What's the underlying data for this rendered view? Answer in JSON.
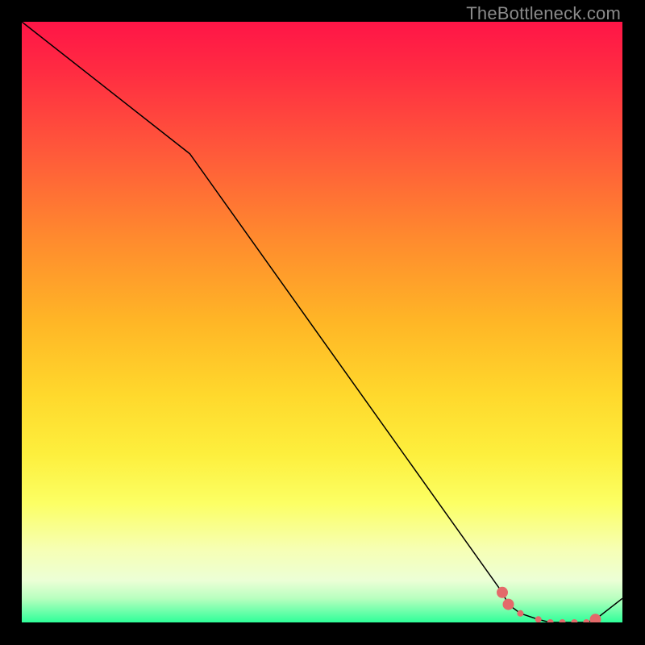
{
  "watermark": "TheBottleneck.com",
  "chart_data": {
    "type": "line",
    "title": "",
    "xlabel": "",
    "ylabel": "",
    "x": [
      0.0,
      0.28,
      0.8,
      0.81,
      0.83,
      0.86,
      0.88,
      0.9,
      0.92,
      0.94,
      0.955,
      1.0
    ],
    "values": [
      1.0,
      0.78,
      0.05,
      0.03,
      0.015,
      0.005,
      0.0,
      0.0,
      0.0,
      0.0,
      0.005,
      0.04
    ],
    "xlim": [
      0,
      1
    ],
    "ylim": [
      0,
      1
    ],
    "markers_x": [
      0.8,
      0.81,
      0.83,
      0.86,
      0.88,
      0.9,
      0.92,
      0.94,
      0.955
    ],
    "markers_y": [
      0.05,
      0.03,
      0.015,
      0.005,
      0.0,
      0.0,
      0.0,
      0.0,
      0.005
    ],
    "markers_size": [
      "big",
      "big",
      "small",
      "small",
      "small",
      "small",
      "small",
      "small",
      "big"
    ]
  }
}
